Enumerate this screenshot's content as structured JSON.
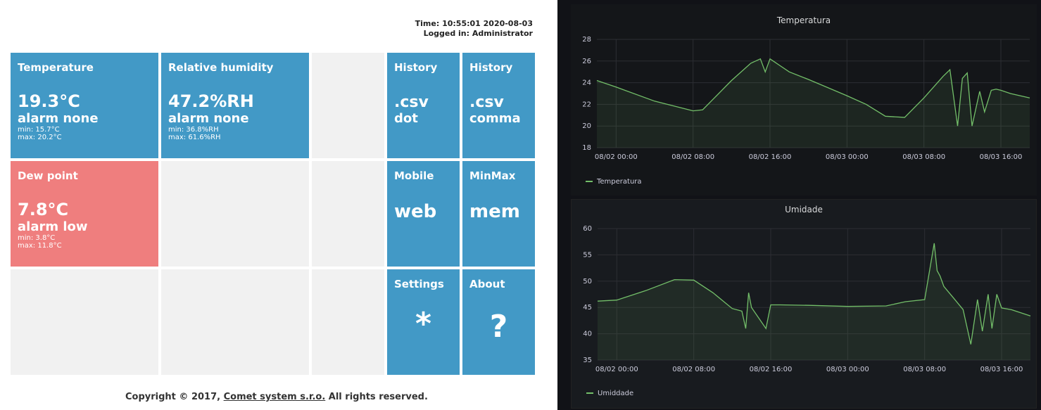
{
  "status": {
    "time": "Time: 10:55:01 2020-08-03",
    "user": "Logged in: Administrator"
  },
  "tiles": {
    "temperature": {
      "title": "Temperature",
      "value": "19.3°C",
      "alarm": "alarm none",
      "min": "min: 15.7°C",
      "max": "max: 20.2°C"
    },
    "humidity": {
      "title": "Relative humidity",
      "value": "47.2%RH",
      "alarm": "alarm none",
      "min": "min: 36.8%RH",
      "max": "max: 61.6%RH"
    },
    "dewpoint": {
      "title": "Dew point",
      "value": "7.8°C",
      "alarm": "alarm low",
      "min": "min: 3.8°C",
      "max": "max: 11.8°C"
    },
    "history_dot": {
      "title": "History",
      "line1": ".csv",
      "line2": "dot"
    },
    "history_comma": {
      "title": "History",
      "line1": ".csv",
      "line2": "comma"
    },
    "mobile": {
      "title": "Mobile",
      "line1": "web"
    },
    "minmax": {
      "title": "MinMax",
      "line1": "mem"
    },
    "settings": {
      "title": "Settings",
      "symbol": "*"
    },
    "about": {
      "title": "About",
      "symbol": "?"
    }
  },
  "footer": {
    "prefix": "Copyright © 2017, ",
    "link": "Comet system s.r.o.",
    "suffix": " All rights reserved."
  },
  "colors": {
    "tile_blue": "#4299c6",
    "tile_red": "#ef7e7e",
    "tile_empty": "#f1f1f1",
    "dashboard_bg": "#111217",
    "series_green": "#73bf69"
  },
  "chart_data": [
    {
      "type": "line",
      "title": "Temperatura",
      "x_ticks": [
        "08/02 00:00",
        "08/02 08:00",
        "08/02 16:00",
        "08/03 00:00",
        "08/03 08:00",
        "08/03 16:00"
      ],
      "y_ticks": [
        18,
        20,
        22,
        24,
        26,
        28
      ],
      "ylim": [
        18,
        28
      ],
      "xlim_hours": [
        -2,
        43
      ],
      "grid": true,
      "legend_position": "bottom-left",
      "series": [
        {
          "name": "Temperatura",
          "x": [
            -2,
            0,
            4,
            8,
            9,
            12,
            14,
            15,
            15.5,
            16,
            16.5,
            17,
            18,
            20,
            24,
            26,
            28,
            30,
            32,
            34,
            34.7,
            35.5,
            36,
            36.5,
            37,
            37.8,
            38.3,
            39,
            39.5,
            40,
            41,
            42,
            43
          ],
          "y": [
            24.2,
            23.6,
            22.3,
            21.4,
            21.5,
            24.2,
            25.8,
            26.2,
            25.0,
            26.2,
            25.9,
            25.6,
            25.0,
            24.3,
            22.8,
            22.0,
            20.9,
            20.8,
            22.6,
            24.6,
            25.2,
            20.0,
            24.4,
            24.9,
            20.0,
            23.2,
            21.3,
            23.3,
            23.4,
            23.3,
            23.0,
            22.8,
            22.6
          ]
        }
      ]
    },
    {
      "type": "line",
      "title": "Umidade",
      "x_ticks": [
        "08/02 00:00",
        "08/02 08:00",
        "08/02 16:00",
        "08/03 00:00",
        "08/03 08:00",
        "08/03 16:00"
      ],
      "y_ticks": [
        35,
        40,
        45,
        50,
        55,
        60
      ],
      "ylim": [
        35,
        60
      ],
      "xlim_hours": [
        -2,
        43
      ],
      "grid": true,
      "legend_position": "bottom-left",
      "series": [
        {
          "name": "Umiddade",
          "x": [
            -2,
            0,
            3,
            6,
            8,
            10,
            12,
            13,
            13.4,
            13.7,
            14,
            15.5,
            16,
            17,
            20,
            24,
            28,
            30,
            32,
            33,
            33.3,
            33.6,
            34,
            35,
            36,
            36.8,
            37.5,
            38,
            38.6,
            39,
            39.5,
            40,
            41,
            43
          ],
          "y": [
            46.2,
            46.4,
            48.2,
            50.3,
            50.2,
            47.8,
            44.8,
            44.3,
            41.0,
            47.8,
            45.0,
            41.0,
            45.5,
            45.5,
            45.4,
            45.2,
            45.3,
            46.1,
            46.5,
            57.2,
            52.0,
            51.0,
            49.0,
            46.8,
            44.6,
            38.0,
            46.5,
            40.5,
            47.5,
            41.0,
            47.5,
            44.9,
            44.6,
            43.4
          ]
        }
      ]
    }
  ]
}
